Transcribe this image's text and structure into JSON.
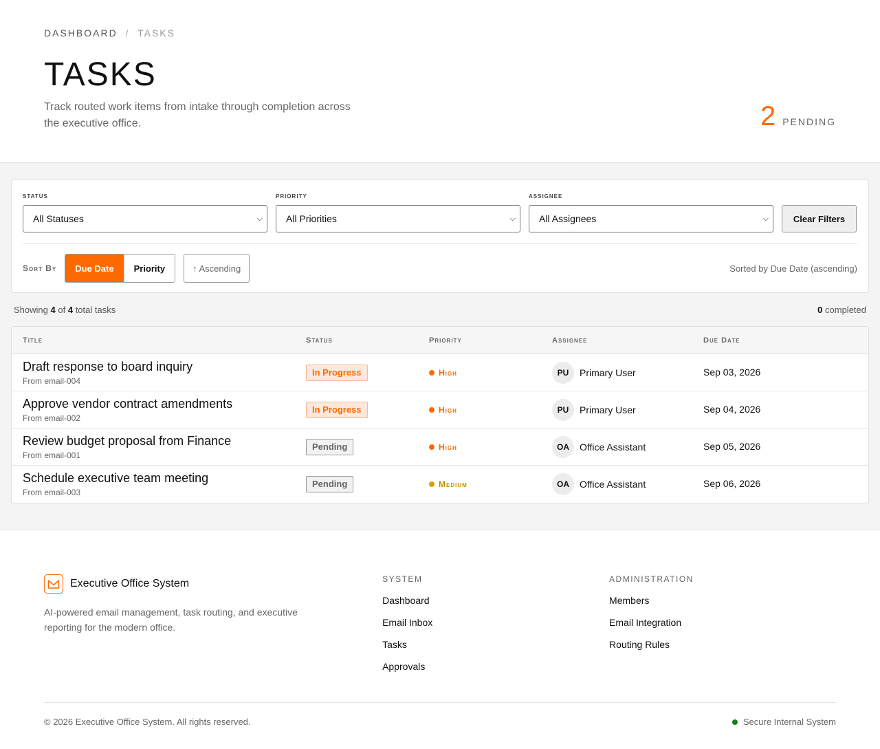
{
  "breadcrumb": {
    "parent": "Dashboard",
    "separator": "/",
    "current": "Tasks"
  },
  "header": {
    "title": "TASKS",
    "description": "Track routed work items from intake through completion across the executive office.",
    "pending_count": "2",
    "pending_label": "PENDING"
  },
  "filters": {
    "status": {
      "label": "Status",
      "value": "All Statuses"
    },
    "priority": {
      "label": "Priority",
      "value": "All Priorities"
    },
    "assignee": {
      "label": "Assignee",
      "value": "All Assignees"
    },
    "clear_label": "Clear Filters"
  },
  "sort": {
    "label": "Sort By",
    "options": [
      "Due Date",
      "Priority"
    ],
    "active": "Due Date",
    "direction_label": "↑ Ascending",
    "summary": "Sorted by Due Date (ascending)"
  },
  "counts": {
    "prefix": "Showing",
    "shown": "4",
    "of": "of",
    "total": "4",
    "suffix": "total tasks",
    "completed": "0",
    "completed_label": "completed"
  },
  "table": {
    "columns": [
      "Title",
      "Status",
      "Priority",
      "Assignee",
      "Due Date"
    ],
    "rows": [
      {
        "title": "Draft response to board inquiry",
        "source": "From email-004",
        "status": "In Progress",
        "priority": "High",
        "initials": "PU",
        "assignee": "Primary User",
        "due": "Sep 03, 2026"
      },
      {
        "title": "Approve vendor contract amendments",
        "source": "From email-002",
        "status": "In Progress",
        "priority": "High",
        "initials": "PU",
        "assignee": "Primary User",
        "due": "Sep 04, 2026"
      },
      {
        "title": "Review budget proposal from Finance",
        "source": "From email-001",
        "status": "Pending",
        "priority": "High",
        "initials": "OA",
        "assignee": "Office Assistant",
        "due": "Sep 05, 2026"
      },
      {
        "title": "Schedule executive team meeting",
        "source": "From email-003",
        "status": "Pending",
        "priority": "Medium",
        "initials": "OA",
        "assignee": "Office Assistant",
        "due": "Sep 06, 2026"
      }
    ]
  },
  "footer": {
    "brand_name": "Executive Office System",
    "brand_icon": "mail-icon",
    "description": "AI-powered email management, task routing, and executive reporting for the modern office.",
    "system": {
      "title": "System",
      "links": [
        "Dashboard",
        "Email Inbox",
        "Tasks",
        "Approvals"
      ]
    },
    "admin": {
      "title": "Administration",
      "links": [
        "Members",
        "Email Integration",
        "Routing Rules"
      ]
    },
    "copyright": "© 2026 Executive Office System. All rights reserved.",
    "secure_label": "Secure Internal System"
  },
  "colors": {
    "accent": "#ff6a00",
    "medium": "#c49000",
    "secure": "#1a7f1a"
  }
}
